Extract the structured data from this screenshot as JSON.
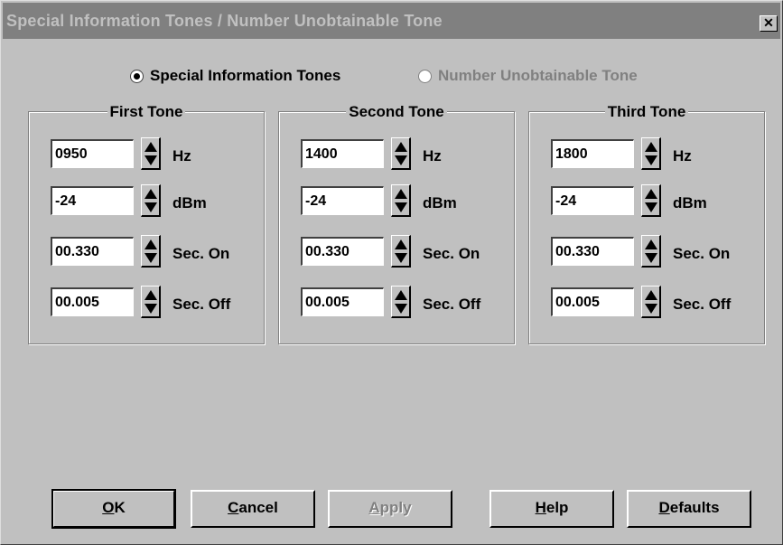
{
  "window": {
    "title": "Special Information Tones / Number Unobtainable Tone",
    "close_icon": "close-icon"
  },
  "mode": {
    "option_sit": {
      "label": "Special Information Tones",
      "selected": true,
      "enabled": true
    },
    "option_nut": {
      "label": "Number Unobtainable Tone",
      "selected": false,
      "enabled": false
    }
  },
  "tones": [
    {
      "title": "First Tone",
      "hz": "0950",
      "dbm": "-24",
      "sec_on": "00.330",
      "sec_off": "00.005"
    },
    {
      "title": "Second Tone",
      "hz": "1400",
      "dbm": "-24",
      "sec_on": "00.330",
      "sec_off": "00.005"
    },
    {
      "title": "Third Tone",
      "hz": "1800",
      "dbm": "-24",
      "sec_on": "00.330",
      "sec_off": "00.005"
    }
  ],
  "labels": {
    "hz": "Hz",
    "dbm": "dBm",
    "sec_on": "Sec. On",
    "sec_off": "Sec. Off"
  },
  "buttons": {
    "ok": {
      "mn": "O",
      "rest": "K",
      "enabled": true
    },
    "cancel": {
      "mn": "C",
      "rest": "ancel",
      "enabled": true
    },
    "apply": {
      "mn": "A",
      "rest": "pply",
      "enabled": false
    },
    "help": {
      "mn": "H",
      "rest": "elp",
      "enabled": true
    },
    "defaults": {
      "mn": "D",
      "rest": "efaults",
      "enabled": true
    }
  },
  "colors": {
    "dialog_bg": "#c0c0c0",
    "titlebar_inactive": "#808080",
    "disabled_text": "#808080"
  }
}
